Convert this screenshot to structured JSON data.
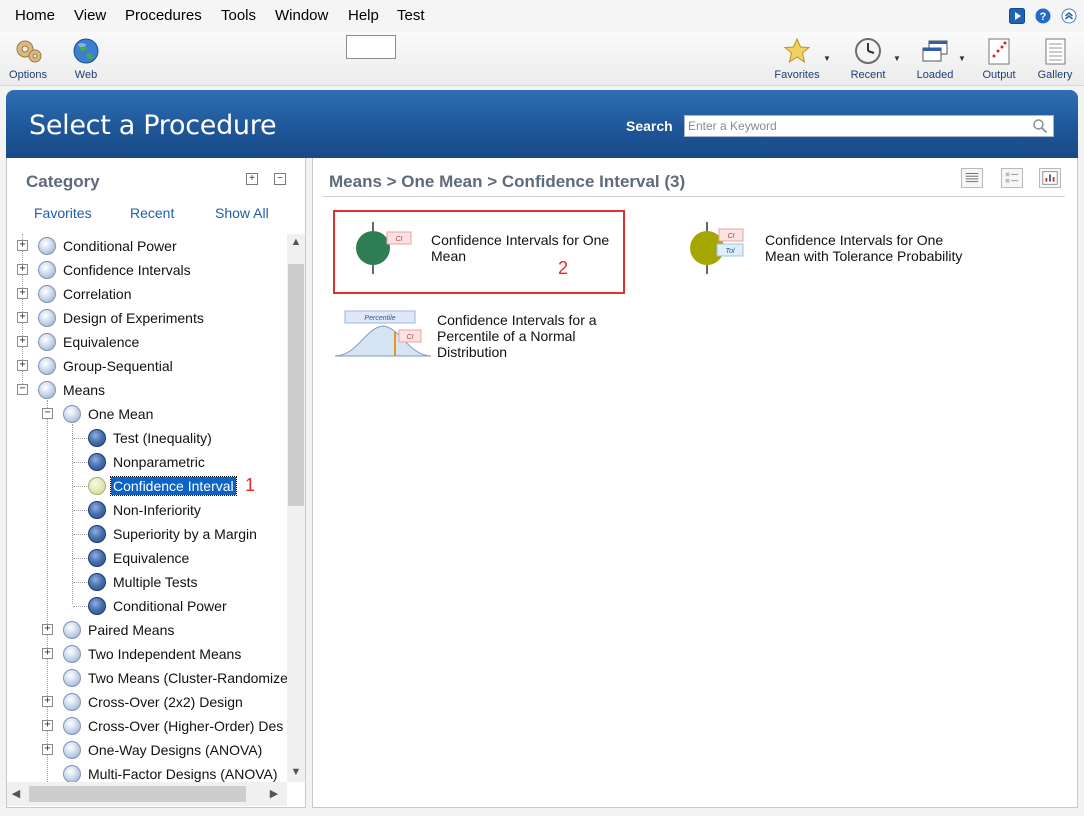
{
  "menu": {
    "items": [
      {
        "label": "Home",
        "ul": "H"
      },
      {
        "label": "View",
        "ul": "V"
      },
      {
        "label": "Procedures",
        "ul": "P"
      },
      {
        "label": "Tools",
        "ul": "T"
      },
      {
        "label": "Window",
        "ul": "W"
      },
      {
        "label": "Help",
        "ul": "H"
      },
      {
        "label": "Test",
        "ul": ""
      }
    ]
  },
  "toolbar": {
    "options_label": "Options",
    "web_label": "Web",
    "favorites_label": "Favorites",
    "recent_label": "Recent",
    "loaded_label": "Loaded",
    "output_label": "Output",
    "gallery_label": "Gallery"
  },
  "header": {
    "title": "Select a Procedure",
    "search_label": "Search",
    "search_placeholder": "Enter a Keyword"
  },
  "category": {
    "title": "Category",
    "tabs": {
      "favorites": "Favorites",
      "recent": "Recent",
      "show_all": "Show All"
    },
    "tree": [
      {
        "label": "Conditional Power"
      },
      {
        "label": "Confidence Intervals"
      },
      {
        "label": "Correlation"
      },
      {
        "label": "Design of Experiments"
      },
      {
        "label": "Equivalence"
      },
      {
        "label": "Group-Sequential"
      },
      {
        "label": "Means"
      },
      {
        "label": "One Mean"
      },
      {
        "label": "Test (Inequality)"
      },
      {
        "label": "Nonparametric"
      },
      {
        "label": "Confidence Interval"
      },
      {
        "label": "Non-Inferiority"
      },
      {
        "label": "Superiority by a Margin"
      },
      {
        "label": "Equivalence"
      },
      {
        "label": "Multiple Tests"
      },
      {
        "label": "Conditional Power"
      },
      {
        "label": "Paired Means"
      },
      {
        "label": "Two Independent Means"
      },
      {
        "label": "Two Means (Cluster-Randomize"
      },
      {
        "label": "Cross-Over (2x2) Design"
      },
      {
        "label": "Cross-Over (Higher-Order) Des"
      },
      {
        "label": "One-Way Designs (ANOVA)"
      },
      {
        "label": "Multi-Factor Designs (ANOVA)"
      }
    ],
    "annotation": "1"
  },
  "results": {
    "breadcrumb": "Means > One Mean > Confidence Interval (3)",
    "annotation": "2",
    "procedures": [
      {
        "title": "Confidence Intervals for One Mean",
        "line1": "Confidence Intervals for One",
        "line2": "Mean",
        "icon_color": "#2f7d54",
        "tag": "CI"
      },
      {
        "title": "Confidence Intervals for One Mean with Tolerance Probability",
        "line1": "Confidence Intervals for One",
        "line2": "Mean with Tolerance Probability",
        "icon_color": "#a6a600",
        "tag": "CI",
        "tag2": "Tol"
      },
      {
        "title": "Confidence Intervals for a Percentile of a Normal Distribution",
        "line1": "Confidence Intervals for a",
        "line2": "Percentile of a Normal",
        "line3": "Distribution",
        "tag": "CI",
        "banner": "Percentile"
      }
    ]
  },
  "colors": {
    "banner": "#1d5597",
    "selection": "#0b63c6",
    "annotation": "#e8262b"
  }
}
